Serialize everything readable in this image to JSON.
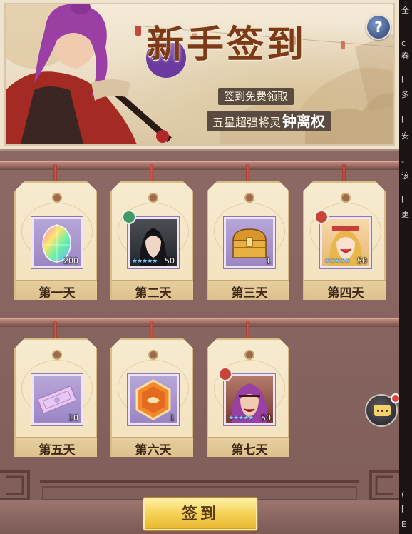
{
  "banner": {
    "title": "新手签到",
    "tag_free": "签到免费领取",
    "tag_hero_prefix": "五星超强将灵",
    "tag_hero_name": "钟离权",
    "help_symbol": "?"
  },
  "days": [
    {
      "label": "第一天",
      "quantity": "200",
      "item": "rainbow-gem",
      "type": "item"
    },
    {
      "label": "第二天",
      "quantity": "50",
      "item": "hero-fragment",
      "type": "hero",
      "element": "wind"
    },
    {
      "label": "第三天",
      "quantity": "1",
      "item": "treasure-chest",
      "type": "item"
    },
    {
      "label": "第四天",
      "quantity": "50",
      "item": "hero-fragment",
      "type": "hero",
      "element": "fire"
    },
    {
      "label": "第五天",
      "quantity": "10",
      "item": "scroll-ticket",
      "type": "item"
    },
    {
      "label": "第六天",
      "quantity": "1",
      "item": "hexagon-token",
      "type": "item"
    },
    {
      "label": "第七天",
      "quantity": "50",
      "item": "hero-fragment",
      "type": "hero",
      "element": "fire"
    }
  ],
  "sign_button": {
    "label": "签到"
  },
  "side_panel": [
    "全",
    "c",
    "春",
    "[",
    "多",
    "[",
    "安",
    "-",
    "该",
    "[",
    "更",
    "(",
    "[",
    "E"
  ],
  "colors": {
    "accent": "#f6d45a",
    "panel": "#8a6763",
    "card": "#f2e1bd",
    "title": "#7d3a18"
  }
}
